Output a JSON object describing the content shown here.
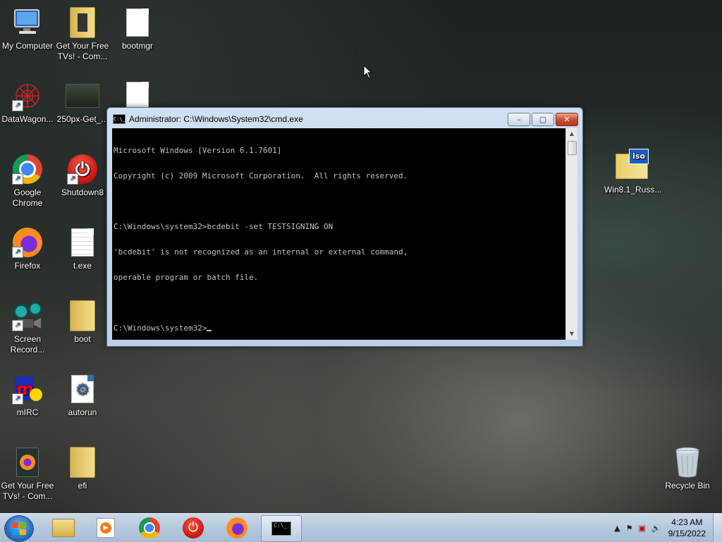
{
  "desktop": {
    "icons": [
      {
        "label": "My Computer",
        "icon": "computer-icon"
      },
      {
        "label": "Get Your Free TVs! - Com...",
        "icon": "folder-icon"
      },
      {
        "label": "bootmgr",
        "icon": "file-icon"
      },
      {
        "label": "DataWagon...",
        "icon": "datawagon-icon"
      },
      {
        "label": "250px-Get_...",
        "icon": "image-icon"
      },
      {
        "label": "",
        "icon": "file-icon"
      },
      {
        "label": "Google Chrome",
        "icon": "chrome-icon"
      },
      {
        "label": "Shutdown8",
        "icon": "power-icon"
      },
      {
        "label": "Win8.1_Russ...",
        "icon": "iso-icon"
      },
      {
        "label": "Firefox",
        "icon": "firefox-icon"
      },
      {
        "label": "t.exe",
        "icon": "file-icon"
      },
      {
        "label": "Screen Record...",
        "icon": "screen-recorder-icon"
      },
      {
        "label": "boot",
        "icon": "folder-icon"
      },
      {
        "label": "mIRC",
        "icon": "mirc-icon"
      },
      {
        "label": "autorun",
        "icon": "settings-file-icon"
      },
      {
        "label": "Get Your Free TVs! - Com...",
        "icon": "firefox-file-icon"
      },
      {
        "label": "efi",
        "icon": "folder-icon"
      },
      {
        "label": "Recycle Bin",
        "icon": "recycle-bin-icon"
      }
    ]
  },
  "cmd": {
    "title": "Administrator: C:\\Windows\\System32\\cmd.exe",
    "icon_text": "C:\\_",
    "lines": [
      "Microsoft Windows [Version 6.1.7601]",
      "Copyright (c) 2009 Microsoft Corporation.  All rights reserved.",
      "",
      "C:\\Windows\\system32>bcdebit -set TESTSIGNING ON",
      "'bcdebit' is not recognized as an internal or external command,",
      "operable program or batch file.",
      "",
      "C:\\Windows\\system32>"
    ],
    "controls": {
      "minimize": "–",
      "maximize": "▢",
      "close": "✕"
    }
  },
  "taskbar": {
    "items": [
      "explorer",
      "media-player",
      "chrome",
      "shutdown",
      "firefox",
      "cmd"
    ],
    "tray_arrow": "▲",
    "clock_time": "4:23 AM",
    "clock_date": "9/15/2022"
  },
  "colors": {
    "console_bg": "#000000",
    "console_fg": "#c0c0c0",
    "taskbar": "#b5c9de"
  }
}
